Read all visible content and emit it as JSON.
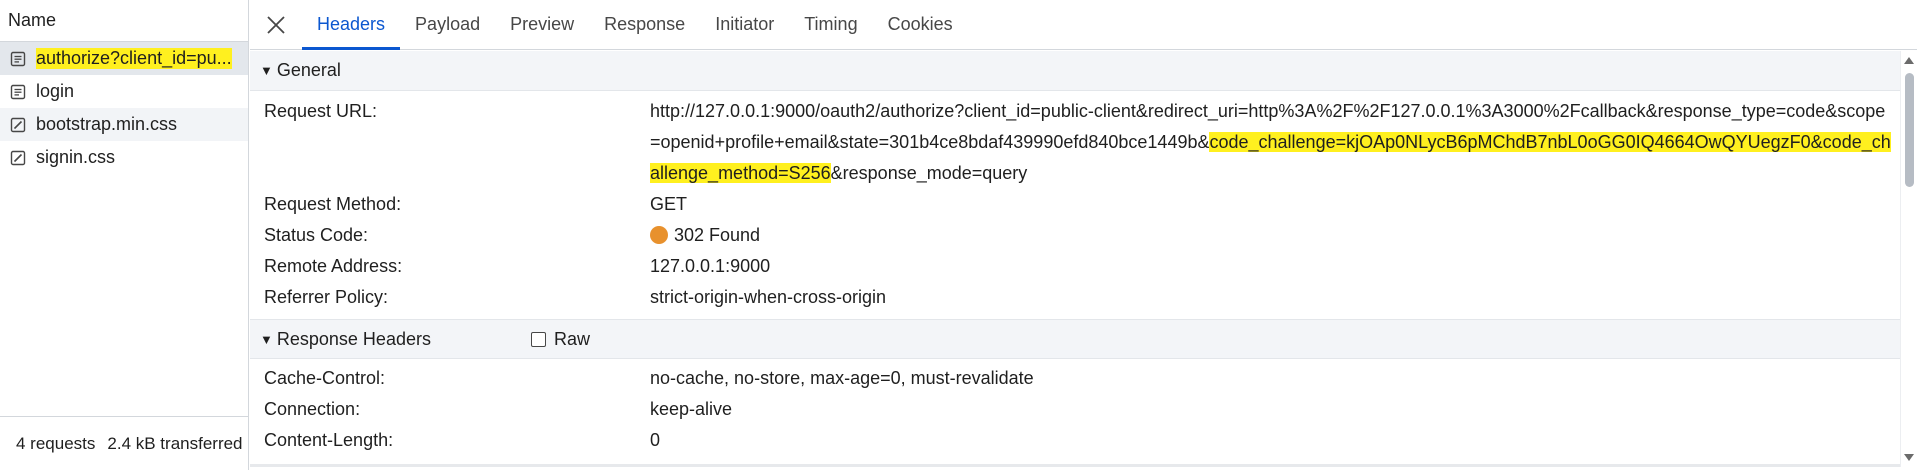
{
  "left": {
    "column_header": "Name",
    "requests": [
      {
        "name": "authorize?client_id=pu...",
        "type": "document"
      },
      {
        "name": "login",
        "type": "document"
      },
      {
        "name": "bootstrap.min.css",
        "type": "stylesheet"
      },
      {
        "name": "signin.css",
        "type": "stylesheet"
      }
    ],
    "footer": {
      "requests": "4 requests",
      "transferred": "2.4 kB transferred"
    }
  },
  "tabs": [
    "Headers",
    "Payload",
    "Preview",
    "Response",
    "Initiator",
    "Timing",
    "Cookies"
  ],
  "general": {
    "title": "General",
    "request_url_label": "Request URL:",
    "request_url_part1": "http://127.0.0.1:9000/oauth2/authorize?client_id=public-client&redirect_uri=http%3A%2F%2F127.0.0.1%3A3000%2Fcallback&response_type=code&scope=openid+profile+email&state=301b4ce8bdaf439990efd840bce1449b&",
    "request_url_highlight": "code_challenge=kjOAp0NLycB6pMChdB7nbL0oGG0IQ4664OwQYUegzF0&code_challenge_method=S256",
    "request_url_part2": "&response_mode=query",
    "request_method_label": "Request Method:",
    "request_method": "GET",
    "status_code_label": "Status Code:",
    "status_code": "302 Found",
    "remote_address_label": "Remote Address:",
    "remote_address": "127.0.0.1:9000",
    "referrer_policy_label": "Referrer Policy:",
    "referrer_policy": "strict-origin-when-cross-origin"
  },
  "response_headers": {
    "title": "Response Headers",
    "raw_label": "Raw",
    "items": [
      {
        "key": "Cache-Control:",
        "value": "no-cache, no-store, max-age=0, must-revalidate"
      },
      {
        "key": "Connection:",
        "value": "keep-alive"
      },
      {
        "key": "Content-Length:",
        "value": "0"
      }
    ]
  },
  "colors": {
    "accent": "#0b57d0",
    "highlight": "#fff01f",
    "status_redirect": "#e8912d"
  }
}
